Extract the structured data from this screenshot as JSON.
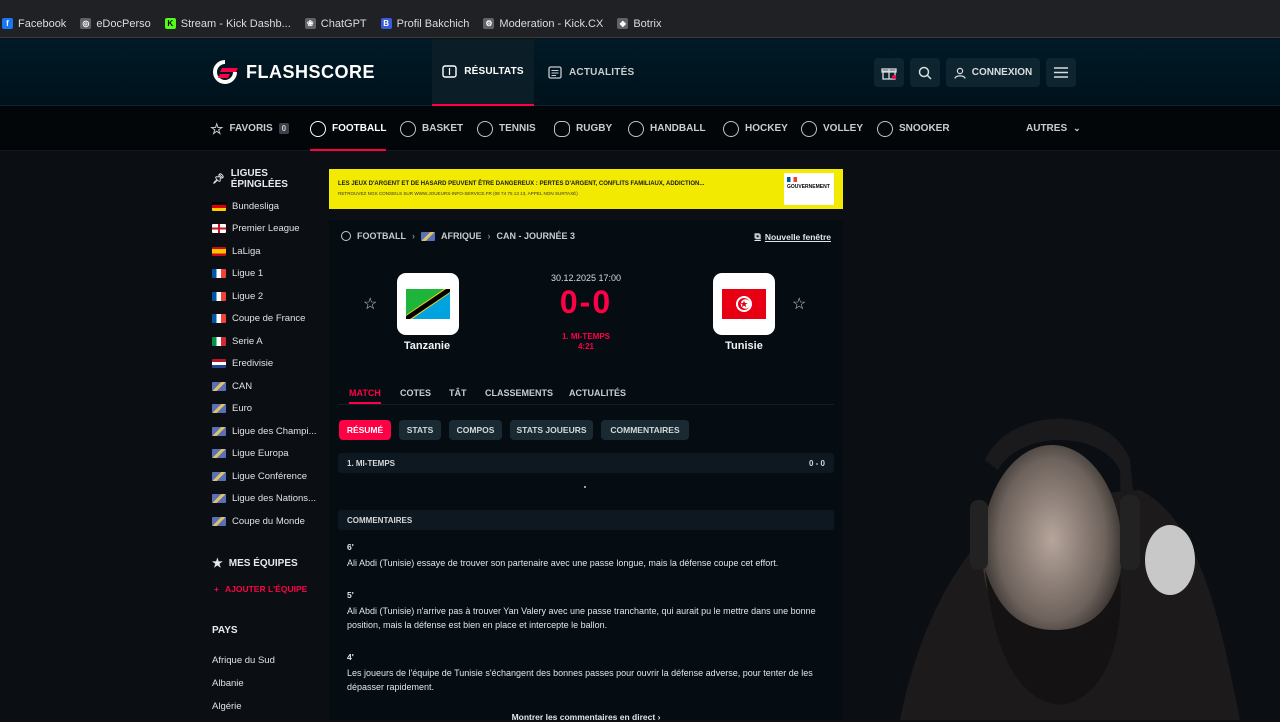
{
  "bookmarks": [
    {
      "label": "Facebook",
      "color": "#1877f2",
      "glyph": "f"
    },
    {
      "label": "eDocPerso",
      "color": "#5f6368",
      "glyph": "◎"
    },
    {
      "label": "Stream - Kick Dashb...",
      "color": "#53fc18",
      "glyph": "K"
    },
    {
      "label": "ChatGPT",
      "color": "#5f6368",
      "glyph": "❀"
    },
    {
      "label": "Profil Bakchich",
      "color": "#3b5bdb",
      "glyph": "B"
    },
    {
      "label": "Moderation - Kick.CX",
      "color": "#5f6368",
      "glyph": "⚙"
    },
    {
      "label": "Botrix",
      "color": "#5f6368",
      "glyph": "◆"
    }
  ],
  "header": {
    "logo": "FLASHSCORE",
    "tab_resultats": "RÉSULTATS",
    "tab_actualites": "ACTUALITÉS",
    "login": "CONNEXION"
  },
  "sports": {
    "favoris": "FAVORIS",
    "favoris_count": "0",
    "football": "FOOTBALL",
    "basket": "BASKET",
    "tennis": "TENNIS",
    "rugby": "RUGBY",
    "handball": "HANDBALL",
    "hockey": "HOCKEY",
    "volley": "VOLLEY",
    "snooker": "SNOOKER",
    "autres": "AUTRES"
  },
  "sidebar": {
    "pinned_title": "LIGUES ÉPINGLÉES",
    "leagues": [
      "Bundesliga",
      "Premier League",
      "LaLiga",
      "Ligue 1",
      "Ligue 2",
      "Coupe de France",
      "Serie A",
      "Eredivisie",
      "CAN",
      "Euro",
      "Ligue des Champi...",
      "Ligue Europa",
      "Ligue Conférence",
      "Ligue des Nations...",
      "Coupe du Monde"
    ],
    "teams_title": "MES ÉQUIPES",
    "add_team": "AJOUTER L'ÉQUIPE",
    "countries_title": "PAYS",
    "countries": [
      "Afrique du Sud",
      "Albanie",
      "Algérie"
    ]
  },
  "banner": {
    "line1": "LES JEUX D'ARGENT ET DE HASARD PEUVENT ÊTRE DANGEREUX : PERTES D'ARGENT, CONFLITS FAMILIAUX, ADDICTION...",
    "line2": "RETROUVEZ NOS CONSEILS SUR WWW.JOUEURS-INFO-SERVICE.FR (09 74 75 13 13, APPEL NON SURTAXÉ)",
    "gov": "GOUVERNEMENT"
  },
  "match": {
    "crumb_sport": "FOOTBALL",
    "crumb_region": "AFRIQUE",
    "crumb_round": "CAN - JOURNÉE 3",
    "new_window": "Nouvelle fenêtre",
    "datetime": "30.12.2025 17:00",
    "score": "0-0",
    "status_line1": "1. MI-TEMPS",
    "status_line2": "4:21",
    "home": "Tanzanie",
    "away": "Tunisie"
  },
  "match_tabs": [
    "MATCH",
    "COTES",
    "TÂT",
    "CLASSEMENTS",
    "ACTUALITÉS"
  ],
  "sub_tabs": [
    "RÉSUMÉ",
    "STATS",
    "COMPOS",
    "STATS JOUEURS",
    "COMMENTAIRES"
  ],
  "half": {
    "label": "1. MI-TEMPS",
    "score": "0 - 0"
  },
  "comments": {
    "title": "COMMENTAIRES",
    "items": [
      {
        "minute": "6'",
        "text": "Ali Abdi (Tunisie) essaye de trouver son partenaire avec une passe longue, mais la défense coupe cet effort."
      },
      {
        "minute": "5'",
        "text": "Ali Abdi (Tunisie) n'arrive pas à trouver Yan Valery avec une passe tranchante, qui aurait pu le mettre dans une bonne position, mais la défense est bien en place et intercepte le ballon."
      },
      {
        "minute": "4'",
        "text": "Les joueurs de l'équipe de Tunisie s'échangent des bonnes passes pour ouvrir la défense adverse, pour tenter de les dépasser rapidement."
      }
    ],
    "show_more": "Montrer les commentaires en direct"
  },
  "colors": {
    "accent": "#ff0046",
    "header_bg": "#00141e",
    "banner": "#f2ea00"
  }
}
